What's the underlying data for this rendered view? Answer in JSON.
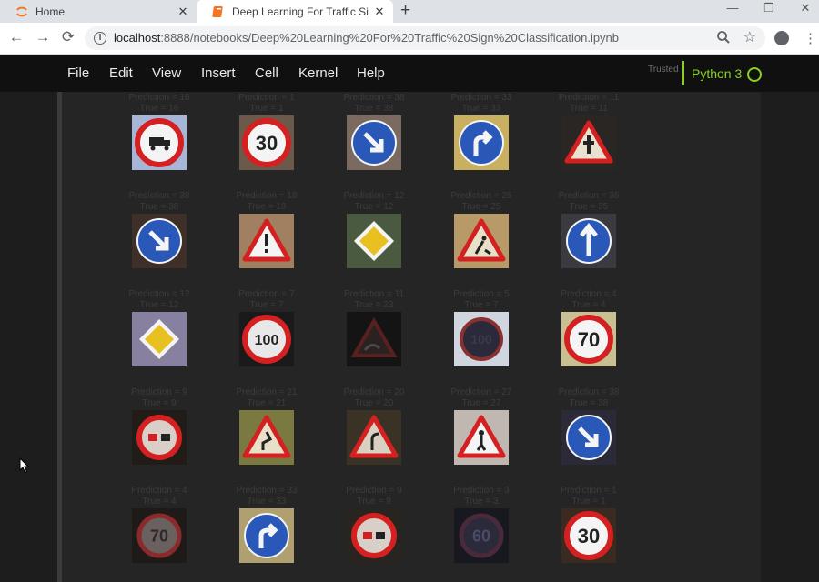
{
  "browser": {
    "tabs": [
      {
        "title": "Home",
        "close": "✕"
      },
      {
        "title": "Deep Learning For Traffic Sign Cla",
        "close": "✕"
      }
    ],
    "new_tab": "+",
    "window_controls": {
      "minimize": "—",
      "restore": "❐",
      "close": "✕"
    },
    "nav": {
      "back": "←",
      "forward": "→",
      "reload": "⟳"
    },
    "url_host": "localhost",
    "url_path": ":8888/notebooks/Deep%20Learning%20For%20Traffic%20Sign%20Classification.ipynb",
    "zoom_icon": "magnifier-icon",
    "star": "☆",
    "menu": "⋮"
  },
  "jupyter": {
    "menu": [
      "File",
      "Edit",
      "View",
      "Insert",
      "Cell",
      "Kernel",
      "Help"
    ],
    "trusted": "Trusted",
    "kernel": "Python 3",
    "accent": "#8ad21c"
  },
  "samples": [
    {
      "prediction": "Prediction = 16",
      "true": "True = 16",
      "sign": "no-trucks",
      "bg": "#a7b6d8"
    },
    {
      "prediction": "Prediction = 1",
      "true": "True = 1",
      "sign": "speed-30",
      "bg": "#6b5a4a"
    },
    {
      "prediction": "Prediction = 38",
      "true": "True = 38",
      "sign": "keep-right",
      "bg": "#7a6a60"
    },
    {
      "prediction": "Prediction = 33",
      "true": "True = 33",
      "sign": "turn-right",
      "bg": "#c9b060"
    },
    {
      "prediction": "Prediction = 11",
      "true": "True = 11",
      "sign": "right-of-way",
      "bg": "#2a2624"
    },
    {
      "prediction": "Prediction = 38",
      "true": "True = 38",
      "sign": "keep-right",
      "bg": "#3e3028"
    },
    {
      "prediction": "Prediction = 18",
      "true": "True = 18",
      "sign": "caution",
      "bg": "#a08060"
    },
    {
      "prediction": "Prediction = 12",
      "true": "True = 12",
      "sign": "priority-road",
      "bg": "#4a5a40"
    },
    {
      "prediction": "Prediction = 25",
      "true": "True = 25",
      "sign": "road-work",
      "bg": "#b89a68"
    },
    {
      "prediction": "Prediction = 35",
      "true": "True = 35",
      "sign": "ahead-only",
      "bg": "#3a3a40"
    },
    {
      "prediction": "Prediction = 12",
      "true": "True = 12",
      "sign": "priority-road",
      "bg": "#8880a0"
    },
    {
      "prediction": "Prediction = 7",
      "true": "True = 7",
      "sign": "speed-100",
      "bg": "#1a1a1a"
    },
    {
      "prediction": "Prediction = 11",
      "true": "True = 23",
      "sign": "slippery-road",
      "bg": "#141414"
    },
    {
      "prediction": "Prediction = 5",
      "true": "True = 7",
      "sign": "speed-dark",
      "bg": "#d0d6e0"
    },
    {
      "prediction": "Prediction = 4",
      "true": "True = 4",
      "sign": "speed-70",
      "bg": "#c8c090"
    },
    {
      "prediction": "Prediction = 9",
      "true": "True = 9",
      "sign": "no-passing",
      "bg": "#221c18"
    },
    {
      "prediction": "Prediction = 21",
      "true": "True = 21",
      "sign": "double-curve",
      "bg": "#7a7a40"
    },
    {
      "prediction": "Prediction = 20",
      "true": "True = 20",
      "sign": "curve-right",
      "bg": "#3a3224"
    },
    {
      "prediction": "Prediction = 27",
      "true": "True = 27",
      "sign": "pedestrians",
      "bg": "#c0b8b0"
    },
    {
      "prediction": "Prediction = 38",
      "true": "True = 38",
      "sign": "keep-right",
      "bg": "#2a2a38"
    },
    {
      "prediction": "Prediction = 4",
      "true": "True = 4",
      "sign": "speed-70-dark",
      "bg": "#1e1a18"
    },
    {
      "prediction": "Prediction = 33",
      "true": "True = 33",
      "sign": "turn-right",
      "bg": "#b0a070"
    },
    {
      "prediction": "Prediction = 9",
      "true": "True = 9",
      "sign": "no-passing",
      "bg": "#2a2420"
    },
    {
      "prediction": "Prediction = 3",
      "true": "True = 3",
      "sign": "speed-60-dark",
      "bg": "#181820"
    },
    {
      "prediction": "Prediction = 1",
      "true": "True = 1",
      "sign": "speed-30",
      "bg": "#3a2a20"
    }
  ]
}
